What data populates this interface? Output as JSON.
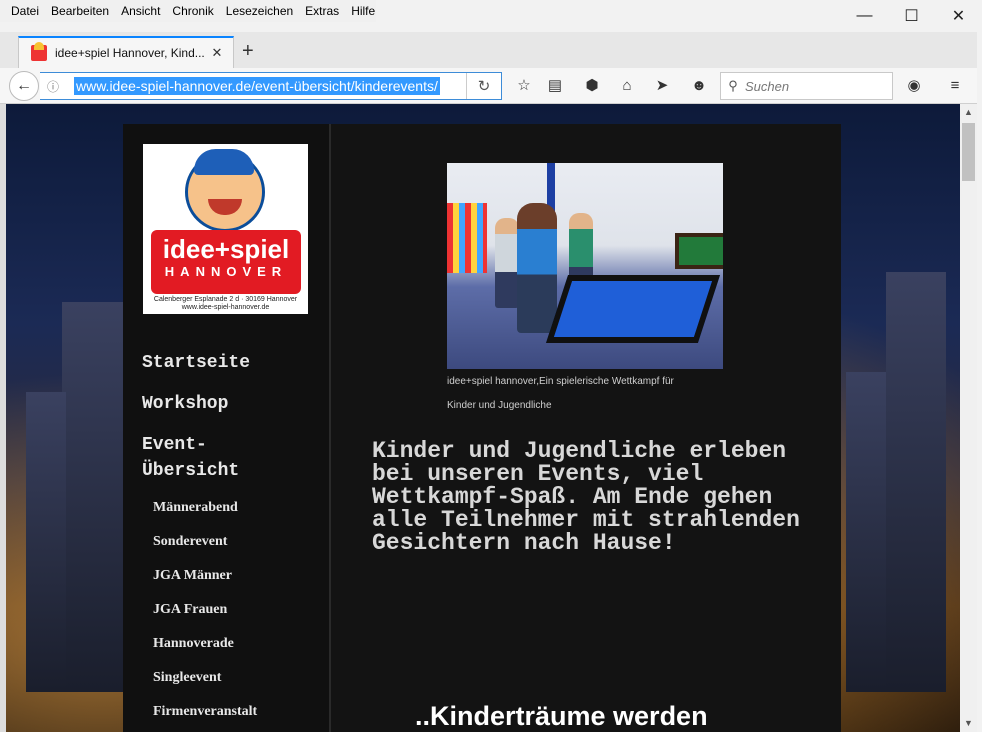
{
  "menubar": [
    "Datei",
    "Bearbeiten",
    "Ansicht",
    "Chronik",
    "Lesezeichen",
    "Extras",
    "Hilfe"
  ],
  "window_controls": {
    "minimize": "—",
    "maximize": "☐",
    "close": "✕"
  },
  "tab": {
    "title": "idee+spiel Hannover, Kind...",
    "close": "✕",
    "new_tab": "+"
  },
  "toolbar": {
    "url": "www.idee-spiel-hannover.de/event-übersicht/kinderevents/",
    "search_placeholder": "Suchen"
  },
  "sidebar": {
    "logo": {
      "brand": "idee+spiel",
      "city": "HANNOVER",
      "address": "Calenberger Esplanade 2 d · 30169 Hannover",
      "web": "www.idee-spiel-hannover.de"
    },
    "main_nav": [
      "Startseite",
      "Workshop",
      "Event-\nÜbersicht"
    ],
    "sub_nav": [
      "Männerabend",
      "Sonderevent",
      "JGA Männer",
      "JGA Frauen",
      "Hannoverade",
      "Singleevent",
      "Firmenveranstalt"
    ]
  },
  "content": {
    "caption_line1": "idee+spiel hannover,Ein spielerische Wettkampf für",
    "caption_line2": "Kinder und Jugendliche",
    "headline": "Kinder und Jugendliche erleben bei unseren Events, viel Wettkampf-Spaß. Am Ende gehen alle Teilnehmer mit strahlenden Gesichtern nach Hause!",
    "subhead": "..Kinderträume werden"
  }
}
